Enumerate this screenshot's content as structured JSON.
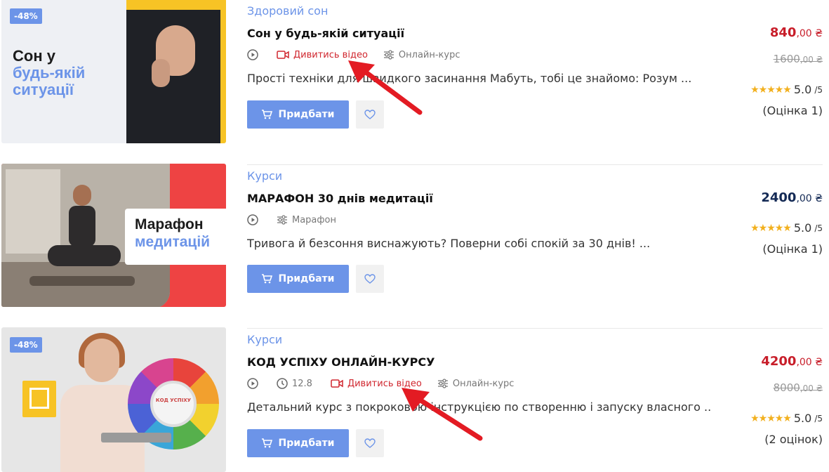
{
  "colors": {
    "accent": "#6c94e8",
    "sale_price": "#c81e2a",
    "regular_price": "#142a55",
    "video_link": "#d0262e",
    "star": "#f2b01e",
    "annotation_arrow": "#e31b23"
  },
  "products": [
    {
      "badge": "-48%",
      "thumb_line1": "Сон у",
      "thumb_line2": "будь-якій",
      "thumb_line3": "ситуації",
      "category": "Здоровий сон",
      "title": "Сон у будь-якій ситуації",
      "video_label": "Дивитись відео",
      "format_label": "Онлайн-курс",
      "description": "Прості техніки для швидкого засинання Мабуть, тобі це знайомо: Розум ...",
      "buy_label": "Придбати",
      "price_main": "840",
      "price_cents": ",00 ₴",
      "old_price_main": "1600",
      "old_price_cents": ",00 ₴",
      "rating_value": "5.0",
      "rating_max": "/5",
      "reviews": "(Оцінка 1)"
    },
    {
      "thumb_line1": "Марафон",
      "thumb_line2": "медитацій",
      "category": "Курси",
      "title": "МАРАФОН 30 днів медитації",
      "format_label": "Марафон",
      "description": "Тривога й безсоння виснажують? Поверни собі спокій за 30 днів! ...",
      "buy_label": "Придбати",
      "price_main": "2400",
      "price_cents": ",00 ₴",
      "rating_value": "5.0",
      "rating_max": "/5",
      "reviews": "(Оцінка 1)"
    },
    {
      "badge": "-48%",
      "wheel_label": "КОД УСПІХУ",
      "category": "Курси",
      "title": "КОД УСПІХУ ОНЛАЙН-КУРСУ",
      "duration": "12.8",
      "video_label": "Дивитись відео",
      "format_label": "Онлайн-курс",
      "description": "Детальний курс з покроковою інструкцією по створенню і запуску власного ...",
      "buy_label": "Придбати",
      "price_main": "4200",
      "price_cents": ",00 ₴",
      "old_price_main": "8000",
      "old_price_cents": ",00 ₴",
      "rating_value": "5.0",
      "rating_max": "/5",
      "reviews": "(2 оцінок)"
    }
  ]
}
